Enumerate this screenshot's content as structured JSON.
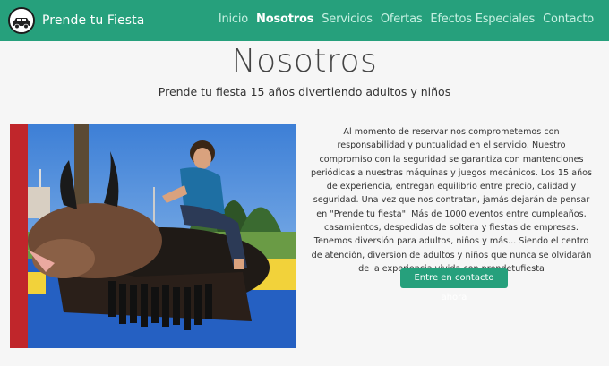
{
  "header": {
    "brand": "Prende tu Fiesta",
    "nav": [
      {
        "label": "Inicio",
        "active": false
      },
      {
        "label": "Nosotros",
        "active": true
      },
      {
        "label": "Servicios",
        "active": false
      },
      {
        "label": "Ofertas",
        "active": false
      },
      {
        "label": "Efectos Especiales",
        "active": false
      },
      {
        "label": "Contacto",
        "active": false
      }
    ],
    "logo_icon": "car-icon",
    "color": "#26a07c"
  },
  "main": {
    "title": "Nosotros",
    "subtitle": "Prende tu fiesta 15 años divertiendo adultos y niños",
    "description": "Al momento de reservar nos comprometemos con responsabilidad y puntualidad en el servicio. Nuestro compromiso con la seguridad se garantiza con mantenciones periódicas a nuestras máquinas y juegos mecánicos. Los 15 años de experiencia, entregan equilibrio entre precio, calidad y seguridad. Una vez que nos contratan, jamás dejarán de pensar en \"Prende tu fiesta\". Más de 1000 eventos entre cumpleaños, casamientos, despedidas de soltera y fiestas de empresas. Tenemos diversión para adultos, niños y más... Siendo el centro de atención, diversion de adultos y niños que nunca se olvidarán de la experiencia vivida con prendetufiesta",
    "cta_label": "Entre en contacto ahora"
  }
}
